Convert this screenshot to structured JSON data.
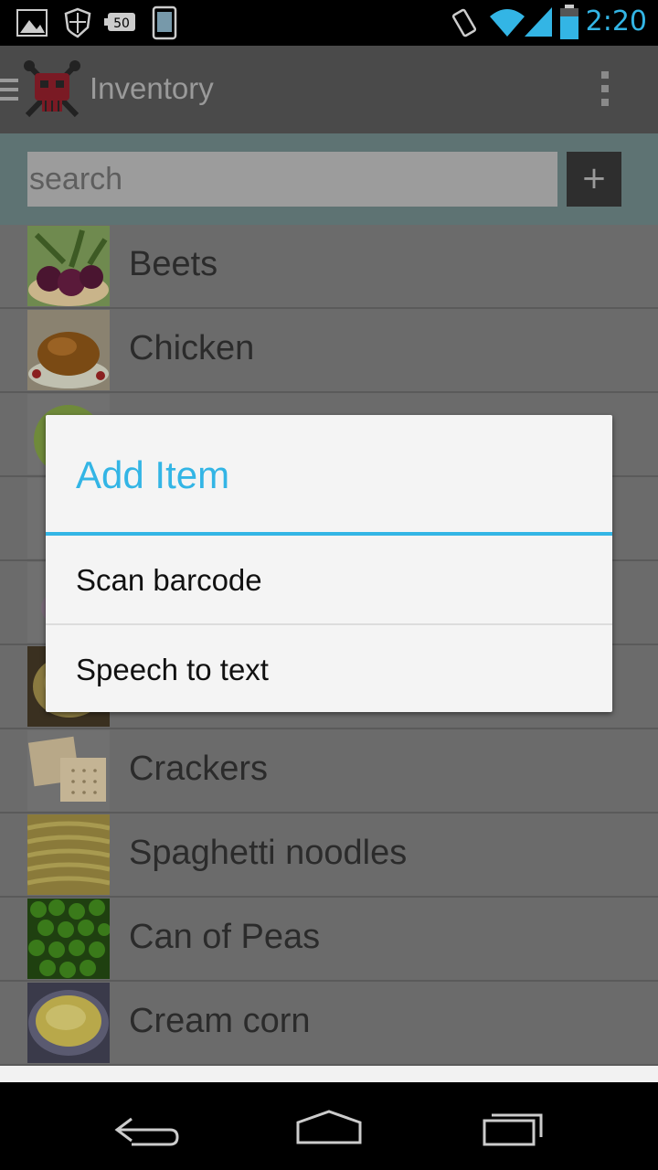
{
  "status_bar": {
    "time": "2:20",
    "icons": [
      "image-icon",
      "shield-icon",
      "battery-50-icon",
      "phone-icon",
      "vibrate-icon",
      "wifi-icon",
      "signal-icon",
      "battery-icon"
    ]
  },
  "action_bar": {
    "title": "Inventory"
  },
  "search": {
    "placeholder": "search",
    "add_label": "+"
  },
  "list": {
    "items": [
      {
        "label": "Beets",
        "thumb": "beets"
      },
      {
        "label": "Chicken",
        "thumb": "chicken"
      },
      {
        "label": "",
        "thumb": "cabbage"
      },
      {
        "label": "",
        "thumb": "bottle"
      },
      {
        "label": "",
        "thumb": "yogurt"
      },
      {
        "label": "",
        "thumb": "hummus"
      },
      {
        "label": "Crackers",
        "thumb": "crackers"
      },
      {
        "label": "Spaghetti noodles",
        "thumb": "spaghetti"
      },
      {
        "label": "Can of Peas",
        "thumb": "peas"
      },
      {
        "label": "Cream corn",
        "thumb": "corn"
      }
    ]
  },
  "dialog": {
    "title": "Add Item",
    "options": [
      "Scan barcode",
      "Speech to text"
    ]
  },
  "colors": {
    "accent": "#33b5e5",
    "action_bar": "#4a4a4a",
    "search_bar": "#5e7373"
  }
}
